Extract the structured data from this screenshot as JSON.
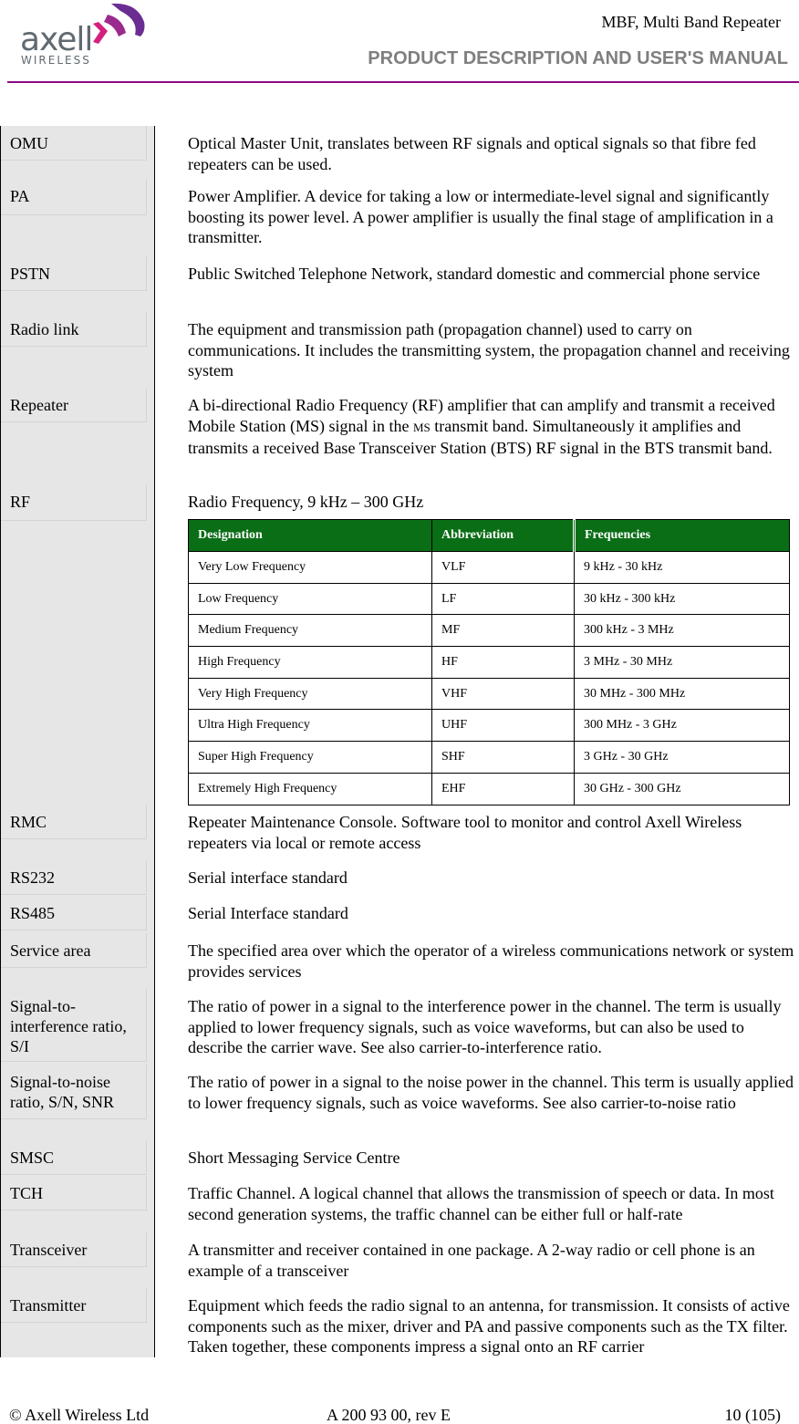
{
  "header": {
    "logo_main": "axell",
    "logo_sub": "WIRELESS",
    "title": "MBF, Multi Band Repeater",
    "subtitle": "PRODUCT DESCRIPTION AND USER'S MANUAL",
    "rule_color": "#8b0a82"
  },
  "glossary": [
    {
      "term": "OMU",
      "desc": "Optical Master Unit, translates between RF signals and optical signals so that fibre fed repeaters can be used."
    },
    {
      "term": "PA",
      "desc": "Power Amplifier. A device for taking a low or intermediate-level signal and significantly boosting its power level. A power amplifier is usually the final stage of amplification in a transmitter."
    },
    {
      "term": "PSTN",
      "desc": "Public Switched Telephone Network, standard domestic and commercial phone service"
    },
    {
      "term": "Radio link",
      "desc": "The equipment and transmission path (propagation channel) used to carry on communications. It includes the transmitting system, the propagation channel and receiving system"
    },
    {
      "term": "Repeater",
      "desc_parts": [
        "A bi-directional Radio Frequency (RF) amplifier that can amplify and transmit a received Mobile Station (MS) signal in the ",
        "MS",
        " transmit band. Simultaneously it amplifies and transmits a received Base Transceiver Station (BTS) RF signal in the BTS transmit band."
      ]
    },
    {
      "term": "RF",
      "desc": "Radio Frequency, 9 kHz – 300 GHz"
    },
    {
      "term": "RMC",
      "desc": "Repeater Maintenance Console. Software tool to monitor and control Axell Wireless repeaters via local or remote access"
    },
    {
      "term": "RS232",
      "desc": "Serial interface standard"
    },
    {
      "term": "RS485",
      "desc": "Serial Interface standard"
    },
    {
      "term": "Service area",
      "desc": "The specified area over which the operator of a wireless communications network or system provides services"
    },
    {
      "term": "Signal-to-interference ratio, S/I",
      "desc": "The ratio of power in a signal to the interference power in the channel. The term is usually applied to lower frequency signals, such as voice waveforms, but can also be used to describe the carrier wave. See also carrier-to-interference ratio."
    },
    {
      "term": "Signal-to-noise ratio, S/N, SNR",
      "desc": "The ratio of power in a signal to the noise power in the channel. This term is usually applied to lower frequency signals, such as voice waveforms. See also carrier-to-noise ratio"
    },
    {
      "term": "SMSC",
      "desc": "Short Messaging Service Centre"
    },
    {
      "term": "TCH",
      "desc": "Traffic Channel. A logical channel that allows the transmission of speech or data. In most second generation systems, the traffic channel can be either full or half-rate"
    },
    {
      "term": "Transceiver",
      "desc": "A transmitter and receiver contained in one package. A 2-way radio or cell phone is an example of a transceiver"
    },
    {
      "term": "Transmitter",
      "desc": "Equipment which feeds the radio signal to an antenna, for transmission. It consists of active components such as the mixer, driver and PA and passive components such as the TX filter. Taken together, these components impress a signal onto an RF carrier"
    }
  ],
  "rf_table": {
    "header_color": "#0a6e16",
    "columns": [
      "Designation",
      "Abbreviation",
      "Frequencies"
    ],
    "rows": [
      [
        "Very Low Frequency",
        "VLF",
        "9 kHz - 30 kHz"
      ],
      [
        "Low Frequency",
        "LF",
        "30 kHz - 300 kHz"
      ],
      [
        "Medium Frequency",
        "MF",
        "300 kHz - 3 MHz"
      ],
      [
        "High Frequency",
        "HF",
        "3 MHz - 30 MHz"
      ],
      [
        "Very High Frequency",
        "VHF",
        "30 MHz - 300 MHz"
      ],
      [
        "Ultra High Frequency",
        "UHF",
        "300 MHz - 3 GHz"
      ],
      [
        "Super High Frequency",
        "SHF",
        "3 GHz - 30 GHz"
      ],
      [
        "Extremely High Frequency",
        "EHF",
        "30 GHz - 300 GHz"
      ]
    ]
  },
  "footer": {
    "copyright": "© Axell Wireless Ltd",
    "doc_number": "A 200 93 00, rev E",
    "page": "10 (105)"
  }
}
